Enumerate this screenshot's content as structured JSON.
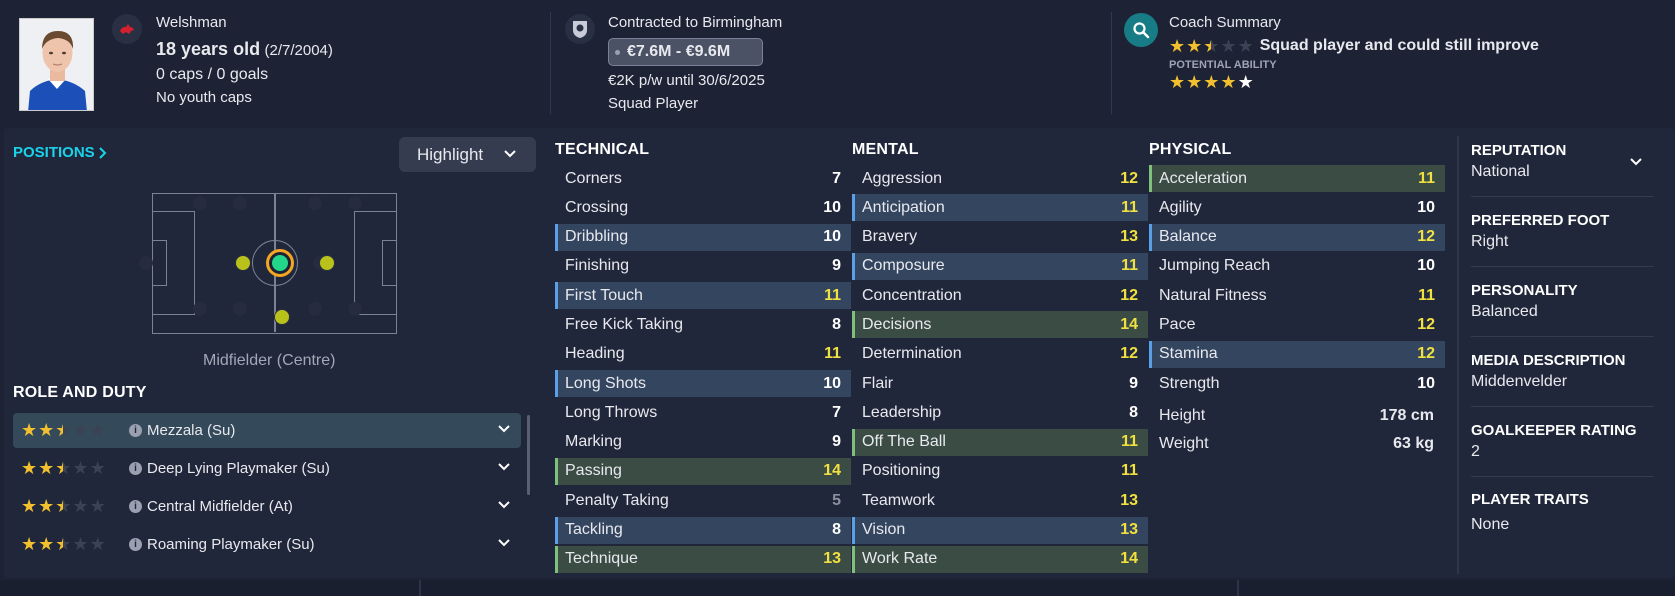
{
  "header": {
    "nationality": "Welshman",
    "age": "18 years old",
    "dob": "(2/7/2004)",
    "caps": "0 caps / 0 goals",
    "youth_caps": "No youth caps",
    "contract": "Contracted to Birmingham",
    "value": "€7.6M - €9.6M",
    "wage": "€2K p/w until 30/6/2025",
    "squad_status": "Squad Player",
    "coach_title": "Coach Summary",
    "coach_summary": "Squad player and could still improve",
    "current_ability_stars": 2.5,
    "potential_label": "POTENTIAL ABILITY",
    "potential_ability_stars": 4
  },
  "positions": {
    "title": "POSITIONS",
    "highlight_label": "Highlight",
    "position_label": "Midfielder (Centre)"
  },
  "roles": {
    "title": "ROLE AND DUTY",
    "items": [
      {
        "label": "Mezzala (Su)",
        "stars": 2.5
      },
      {
        "label": "Deep Lying Playmaker (Su)",
        "stars": 2.5
      },
      {
        "label": "Central Midfielder (At)",
        "stars": 2.5
      },
      {
        "label": "Roaming Playmaker (Su)",
        "stars": 2.5
      }
    ]
  },
  "technical": {
    "title": "TECHNICAL",
    "rows": [
      {
        "name": "Corners",
        "value": "7",
        "hl": "",
        "color": "white"
      },
      {
        "name": "Crossing",
        "value": "10",
        "hl": "",
        "color": "white"
      },
      {
        "name": "Dribbling",
        "value": "10",
        "hl": "blue",
        "color": "white"
      },
      {
        "name": "Finishing",
        "value": "9",
        "hl": "",
        "color": "white"
      },
      {
        "name": "First Touch",
        "value": "11",
        "hl": "blue",
        "color": "yellow"
      },
      {
        "name": "Free Kick Taking",
        "value": "8",
        "hl": "",
        "color": "white"
      },
      {
        "name": "Heading",
        "value": "11",
        "hl": "",
        "color": "yellow"
      },
      {
        "name": "Long Shots",
        "value": "10",
        "hl": "blue",
        "color": "white"
      },
      {
        "name": "Long Throws",
        "value": "7",
        "hl": "",
        "color": "white"
      },
      {
        "name": "Marking",
        "value": "9",
        "hl": "",
        "color": "white"
      },
      {
        "name": "Passing",
        "value": "14",
        "hl": "green",
        "color": "yellow"
      },
      {
        "name": "Penalty Taking",
        "value": "5",
        "hl": "",
        "color": "grey"
      },
      {
        "name": "Tackling",
        "value": "8",
        "hl": "blue",
        "color": "white"
      },
      {
        "name": "Technique",
        "value": "13",
        "hl": "green",
        "color": "yellow"
      }
    ]
  },
  "mental": {
    "title": "MENTAL",
    "rows": [
      {
        "name": "Aggression",
        "value": "12",
        "hl": "",
        "color": "yellow"
      },
      {
        "name": "Anticipation",
        "value": "11",
        "hl": "blue",
        "color": "yellow"
      },
      {
        "name": "Bravery",
        "value": "13",
        "hl": "",
        "color": "yellow"
      },
      {
        "name": "Composure",
        "value": "11",
        "hl": "blue",
        "color": "yellow"
      },
      {
        "name": "Concentration",
        "value": "12",
        "hl": "",
        "color": "yellow"
      },
      {
        "name": "Decisions",
        "value": "14",
        "hl": "green",
        "color": "yellow"
      },
      {
        "name": "Determination",
        "value": "12",
        "hl": "",
        "color": "yellow"
      },
      {
        "name": "Flair",
        "value": "9",
        "hl": "",
        "color": "white"
      },
      {
        "name": "Leadership",
        "value": "8",
        "hl": "",
        "color": "white"
      },
      {
        "name": "Off The Ball",
        "value": "11",
        "hl": "green",
        "color": "yellow"
      },
      {
        "name": "Positioning",
        "value": "11",
        "hl": "",
        "color": "yellow"
      },
      {
        "name": "Teamwork",
        "value": "13",
        "hl": "",
        "color": "yellow"
      },
      {
        "name": "Vision",
        "value": "13",
        "hl": "blue",
        "color": "yellow"
      },
      {
        "name": "Work Rate",
        "value": "14",
        "hl": "green",
        "color": "yellow"
      }
    ]
  },
  "physical": {
    "title": "PHYSICAL",
    "rows": [
      {
        "name": "Acceleration",
        "value": "11",
        "hl": "green",
        "color": "yellow"
      },
      {
        "name": "Agility",
        "value": "10",
        "hl": "",
        "color": "white"
      },
      {
        "name": "Balance",
        "value": "12",
        "hl": "blue",
        "color": "yellow"
      },
      {
        "name": "Jumping Reach",
        "value": "10",
        "hl": "",
        "color": "white"
      },
      {
        "name": "Natural Fitness",
        "value": "11",
        "hl": "",
        "color": "yellow"
      },
      {
        "name": "Pace",
        "value": "12",
        "hl": "",
        "color": "yellow"
      },
      {
        "name": "Stamina",
        "value": "12",
        "hl": "blue",
        "color": "yellow"
      },
      {
        "name": "Strength",
        "value": "10",
        "hl": "",
        "color": "white"
      }
    ],
    "height_label": "Height",
    "height_value": "178 cm",
    "weight_label": "Weight",
    "weight_value": "63 kg"
  },
  "profile": {
    "reputation_title": "REPUTATION",
    "reputation": "National",
    "foot_title": "PREFERRED FOOT",
    "foot": "Right",
    "personality_title": "PERSONALITY",
    "personality": "Balanced",
    "media_title": "MEDIA DESCRIPTION",
    "media": "Middenvelder",
    "gk_title": "GOALKEEPER RATING",
    "gk": "2",
    "traits_title": "PLAYER TRAITS",
    "traits": "None"
  },
  "colors": {
    "accent": "#19d3ea",
    "star": "#f2c02e",
    "highlight_blue": "#34455f",
    "highlight_green": "#3b4c45",
    "value_yellow": "#f0e040"
  }
}
